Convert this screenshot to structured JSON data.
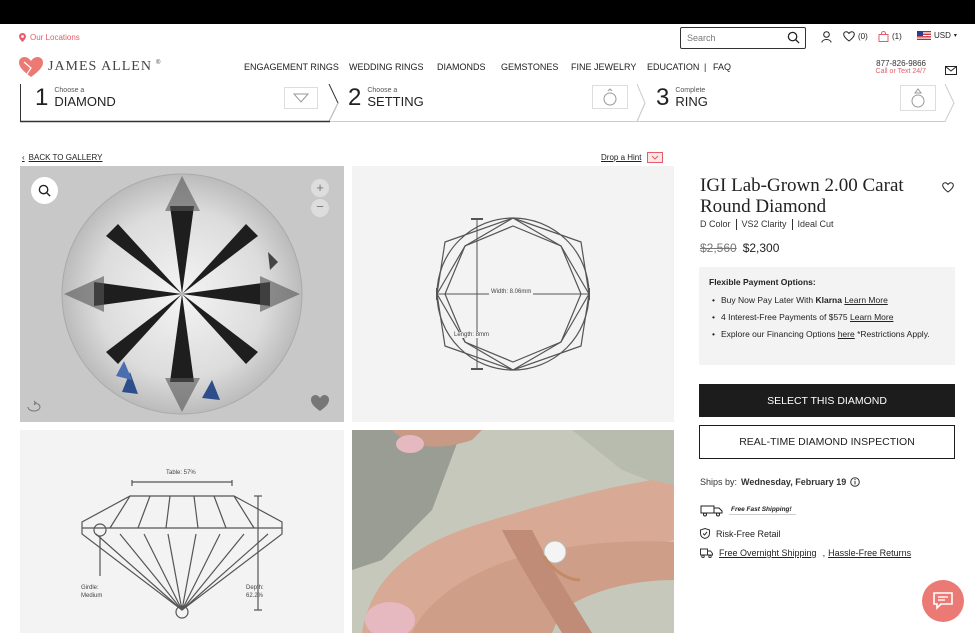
{
  "header": {
    "locations_link": "Our Locations",
    "brand": "JAMES ALLEN",
    "search_placeholder": "Search",
    "wishlist_count": "(0)",
    "cart_count": "(1)",
    "currency": "USD",
    "phone": "877-826-9866",
    "phone_sub": "Call or Text 24/7",
    "nav": [
      "ENGAGEMENT RINGS",
      "WEDDING RINGS",
      "DIAMONDS",
      "GEMSTONES",
      "FINE JEWELRY",
      "EDUCATION",
      "|",
      "FAQ"
    ]
  },
  "steps": [
    {
      "num": "1",
      "small": "Choose a",
      "label": "DIAMOND"
    },
    {
      "num": "2",
      "small": "Choose a",
      "label": "SETTING"
    },
    {
      "num": "3",
      "small": "Complete",
      "label": "RING"
    }
  ],
  "gallery": {
    "back_link": "BACK TO GALLERY",
    "drop_hint": "Drop a Hint",
    "width_label": "Width: 8.06mm",
    "length_label": "Length: 8mm",
    "table_label": "Table: 57%",
    "girdle_label": "Girdle:",
    "girdle_value": "Medium",
    "depth_label": "Depth:",
    "depth_value": "62.2%"
  },
  "product": {
    "title": "IGI Lab-Grown 2.00 Carat Round Diamond",
    "color": "D Color",
    "clarity": "VS2 Clarity",
    "cut": "Ideal Cut",
    "old_price": "$2,560",
    "price": "$2,300",
    "payment_heading": "Flexible Payment Options:",
    "pay1_text": "Buy Now Pay Later With ",
    "pay1_brand": "Klarna",
    "pay1_link": "Learn More",
    "pay2_text": "4 Interest-Free Payments of $575 ",
    "pay2_link": "Learn More",
    "pay3_text": "Explore our Financing Options ",
    "pay3_link": "here",
    "pay3_tail": " *Restrictions Apply.",
    "select_button": "SELECT THIS DIAMOND",
    "inspection_button": "REAL-TIME DIAMOND INSPECTION",
    "ships_label": "Ships by: ",
    "ships_date": "Wednesday, February 19",
    "fast_shipping": "Free Fast Shipping!",
    "risk_free": "Risk-Free Retail",
    "overnight": "Free Overnight Shipping",
    "returns": "Hassle-Free Returns"
  },
  "colors": {
    "accent": "#e35d6a",
    "dark": "#1c1c1c",
    "panel": "#f3f3f3",
    "chat": "#ec7a74"
  }
}
